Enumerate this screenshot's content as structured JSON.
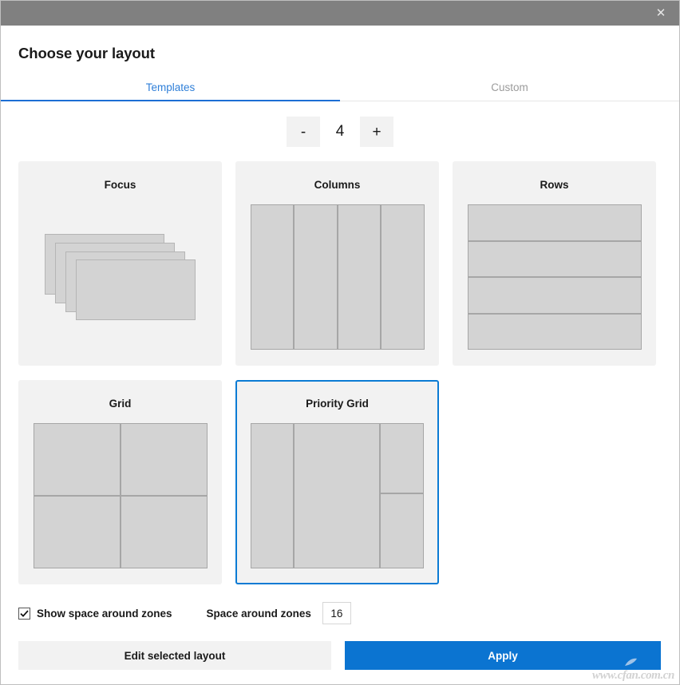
{
  "window": {
    "title": "",
    "close_icon": "close-icon",
    "titlebar_color": "#808080"
  },
  "header": {
    "title": "Choose your layout"
  },
  "tabs": [
    {
      "label": "Templates",
      "active": true
    },
    {
      "label": "Custom",
      "active": false
    }
  ],
  "zone_count": {
    "decrement_label": "-",
    "value": "4",
    "increment_label": "+"
  },
  "templates": [
    {
      "name": "Focus",
      "preview": "cascade",
      "selected": false
    },
    {
      "name": "Columns",
      "preview": "columns",
      "selected": false
    },
    {
      "name": "Rows",
      "preview": "rows",
      "selected": false
    },
    {
      "name": "Grid",
      "preview": "grid",
      "selected": false
    },
    {
      "name": "Priority Grid",
      "preview": "priority-grid",
      "selected": true
    }
  ],
  "options": {
    "show_space_label": "Show space around zones",
    "show_space_checked": true,
    "space_label": "Space around zones",
    "space_value": "16"
  },
  "footer": {
    "edit_label": "Edit selected layout",
    "apply_label": "Apply"
  },
  "watermark": {
    "text": "www.cfan.com.cn"
  },
  "colors": {
    "accent": "#0b74d1",
    "tab_active": "#2f7fd8",
    "selection_border": "#0b7bd4",
    "card_background": "#f2f2f2",
    "zone_fill": "#d3d3d3",
    "zone_border": "#a6a6a6"
  }
}
